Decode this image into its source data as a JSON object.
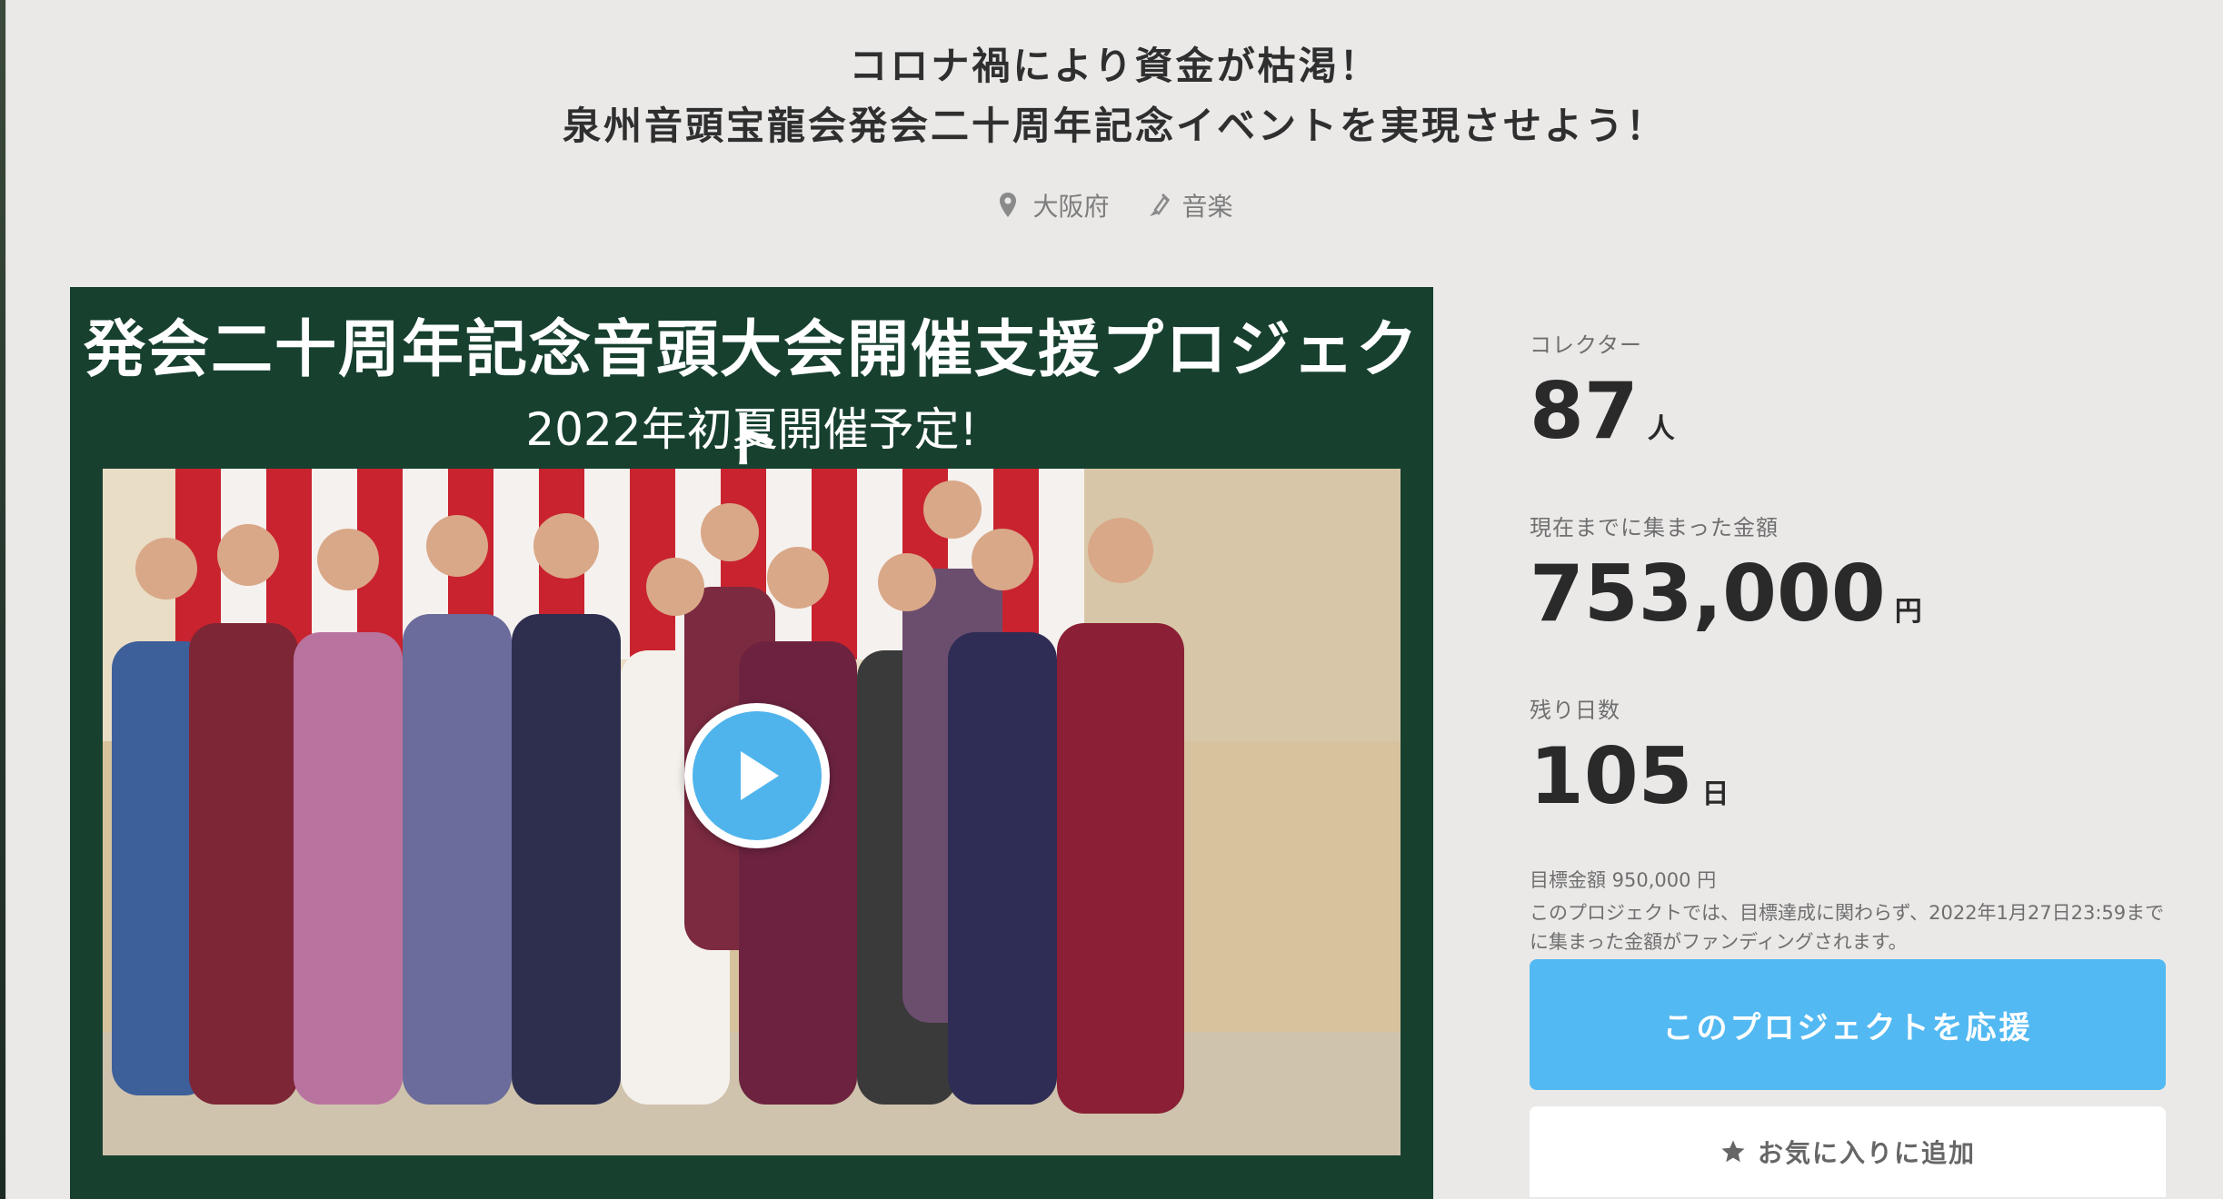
{
  "header": {
    "title_line1": "コロナ禍により資金が枯渇！",
    "title_line2": "泉州音頭宝龍会発会二十周年記念イベントを実現させよう！",
    "location": "大阪府",
    "category": "音楽",
    "location_icon": "map-pin-icon",
    "category_icon": "music-icon"
  },
  "hero": {
    "banner_title": "発会二十周年記念音頭大会開催支援プロジェクト",
    "banner_subtitle": "2022年初夏開催予定!",
    "play_icon": "play-icon",
    "colors": {
      "background": "#17402f",
      "play": "#4fb4ec"
    }
  },
  "stats": {
    "collectors_label": "コレクター",
    "collectors_value": "87",
    "collectors_unit": "人",
    "raised_label": "現在までに集まった金額",
    "raised_value": "753,000",
    "raised_unit": "円",
    "days_label": "残り日数",
    "days_value": "105",
    "days_unit": "日",
    "goal": "目標金額 950,000 円",
    "note": "このプロジェクトでは、目標達成に関わらず、2022年1月27日23:59までに集まった金額がファンディングされます。"
  },
  "actions": {
    "support_label": "このプロジェクトを応援",
    "favorite_label": "お気に入りに追加",
    "favorite_icon": "star-icon",
    "colors": {
      "support": "#52b9f2"
    }
  }
}
